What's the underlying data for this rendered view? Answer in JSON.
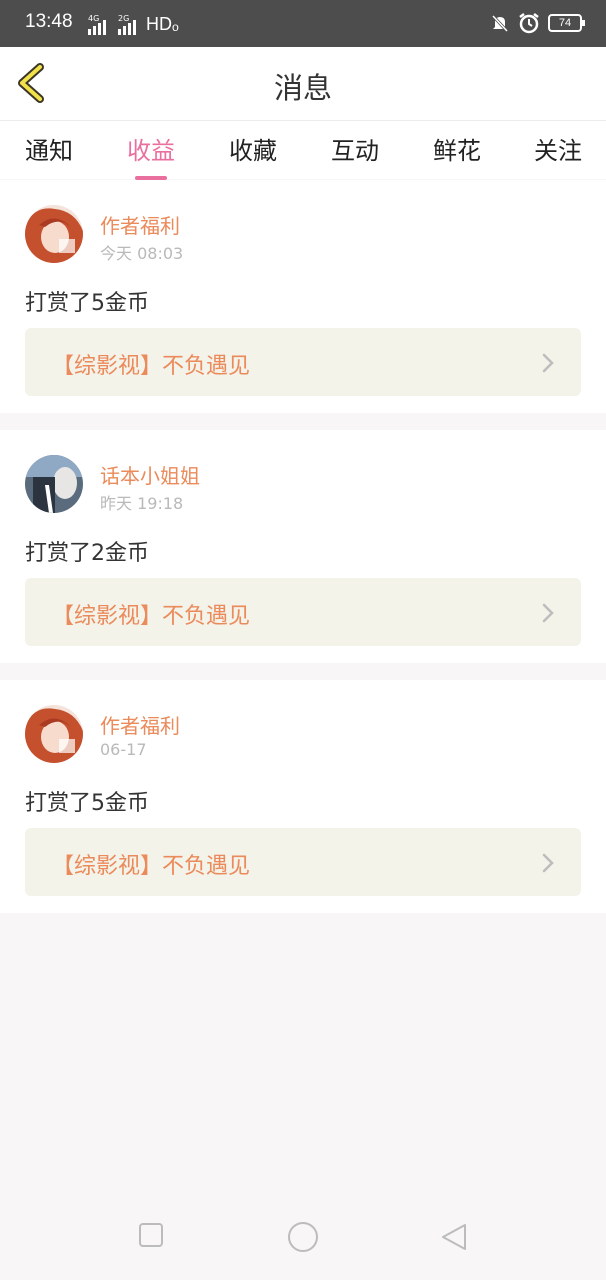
{
  "status_bar": {
    "time": "13:48",
    "signal1_label": "4G",
    "signal2_label": "2G",
    "network_label": "HDₒ",
    "battery_level": "74"
  },
  "header": {
    "title": "消息",
    "back_icon": "chevron-left-icon"
  },
  "tabs": [
    {
      "label": "通知",
      "active": false
    },
    {
      "label": "收益",
      "active": true
    },
    {
      "label": "收藏",
      "active": false
    },
    {
      "label": "互动",
      "active": false
    },
    {
      "label": "鲜花",
      "active": false
    },
    {
      "label": "关注",
      "active": false
    }
  ],
  "messages": [
    {
      "name": "作者福利",
      "time": "今天 08:03",
      "action": "打赏了5金币",
      "book": "【综影视】不负遇见",
      "avatar": "anime-girl-avatar"
    },
    {
      "name": "话本小姐姐",
      "time": "昨天 19:18",
      "action": "打赏了2金币",
      "book": "【综影视】不负遇见",
      "avatar": "photo-avatar"
    },
    {
      "name": "作者福利",
      "time": "06-17",
      "action": "打赏了5金币",
      "book": "【综影视】不负遇见",
      "avatar": "anime-girl-avatar"
    }
  ],
  "colors": {
    "accent_pink": "#e96f9f",
    "name_orange": "#eb8a5a",
    "back_icon_yellow": "#f2e24a"
  }
}
